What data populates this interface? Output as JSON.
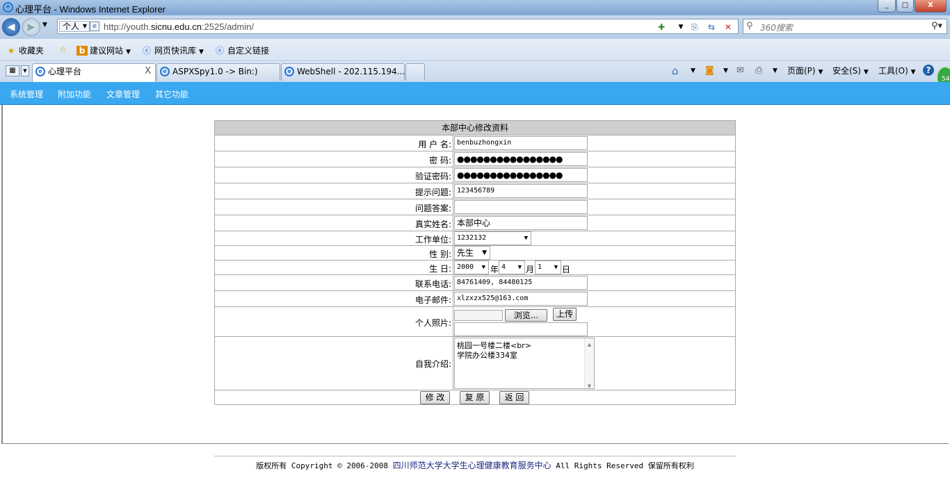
{
  "window": {
    "title": "心理平台 - Windows Internet Explorer",
    "minimize": "_",
    "maximize": "□",
    "close": "X"
  },
  "address": {
    "zone": "个人",
    "url_prefix": "http://youth.",
    "url_domain": "sicnu.edu.cn",
    "url_suffix": ":2525/admin/"
  },
  "search": {
    "placeholder": "360搜索"
  },
  "favorites": {
    "label": "收藏夹",
    "items": [
      "建议网站",
      "网页快讯库",
      "自定义链接"
    ]
  },
  "tabs": [
    {
      "label": "心理平台",
      "close": "X"
    },
    {
      "label": "ASPXSpy1.0 -> Bin:)"
    },
    {
      "label": "WebShell - 202.115.194...."
    }
  ],
  "commands": {
    "page": "页面(P)",
    "safety": "安全(S)",
    "tools": "工具(O)",
    "help": "?"
  },
  "badge": "54",
  "site_nav": [
    "系统管理",
    "附加功能",
    "文章管理",
    "其它功能"
  ],
  "form": {
    "title": "本部中心修改资料",
    "labels": {
      "username": "用 户 名:",
      "password": "密    码:",
      "confirm": "验证密码:",
      "question": "提示问题:",
      "answer": "问题答案:",
      "realname": "真实姓名:",
      "unit": "工作单位:",
      "gender": "性    别:",
      "birthday": "生    日:",
      "phone": "联系电话:",
      "email": "电子邮件:",
      "photo": "个人照片:",
      "intro": "自我介绍:"
    },
    "values": {
      "username": "benbuzhongxin",
      "password": "●●●●●●●●●●●●●●●●",
      "confirm": "●●●●●●●●●●●●●●●●",
      "question": "123456789",
      "answer": "",
      "realname": "本部中心",
      "unit": "1232132",
      "gender": "先生",
      "birth_year": "2000",
      "birth_month": "4",
      "birth_day": "1",
      "phone": "84761409, 84480125",
      "email": "xlzxzx525@163.com",
      "intro_line1": "桃园一号楼二楼<br>",
      "intro_line2": "学院办公楼334室"
    },
    "units": {
      "year": "年",
      "month": "月",
      "day": "日"
    },
    "buttons": {
      "browse": "浏览...",
      "upload": "上传",
      "submit": "修 改",
      "reset": "复 原",
      "back": "返 回"
    }
  },
  "footer": {
    "prefix": "版权所有 Copyright © 2006-2008 ",
    "org": "四川师范大学大学生心理健康教育服务中心",
    "suffix": " All Rights Reserved 保留所有权利"
  }
}
